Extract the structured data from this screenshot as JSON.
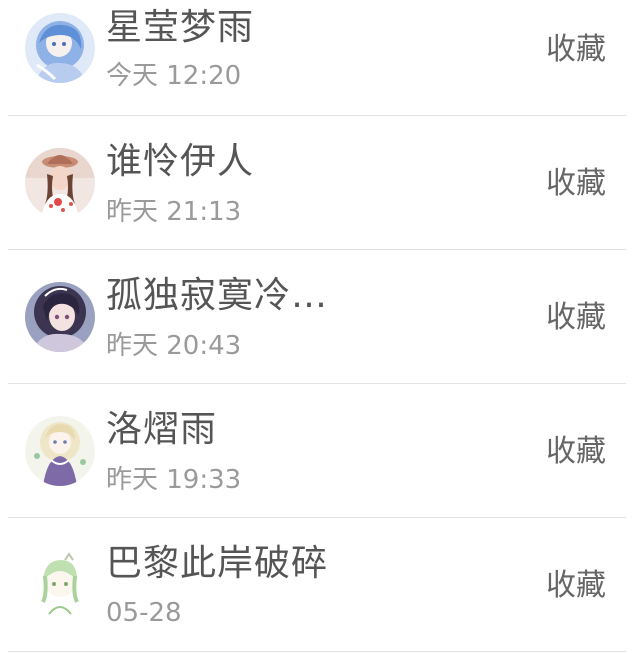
{
  "contacts": [
    {
      "name": "星莹梦雨",
      "time": "今天 12:20",
      "action": "收藏",
      "avatar_icon": "anime-girl-blue-avatar"
    },
    {
      "name": "谁怜伊人",
      "time": "昨天 21:13",
      "action": "收藏",
      "avatar_icon": "girl-with-hat-avatar"
    },
    {
      "name": "孤独寂寞冷…",
      "time": "昨天 20:43",
      "action": "收藏",
      "avatar_icon": "anime-girl-dark-hair-avatar"
    },
    {
      "name": "洛熠雨",
      "time": "昨天 19:33",
      "action": "收藏",
      "avatar_icon": "anime-girl-purple-dress-avatar"
    },
    {
      "name": "巴黎此岸破碎",
      "time": "05-28",
      "action": "收藏",
      "avatar_icon": "chibi-green-hair-avatar"
    }
  ]
}
